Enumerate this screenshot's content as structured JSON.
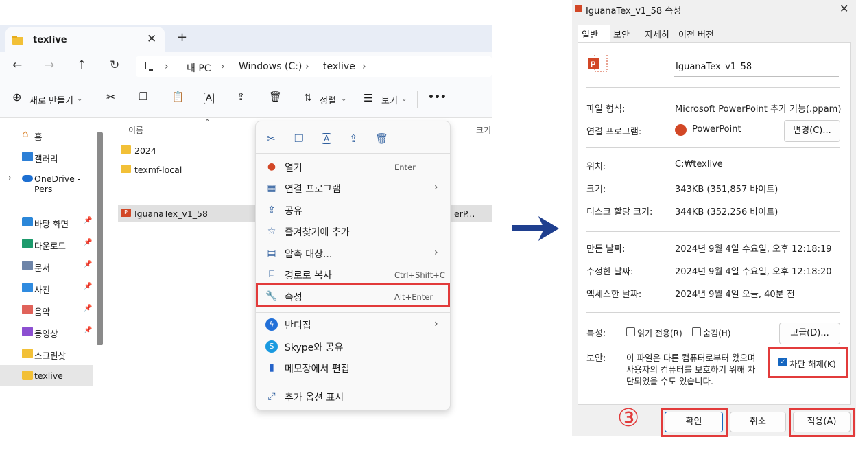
{
  "explorer": {
    "tab_title": "texlive",
    "breadcrumb": [
      "내 PC",
      "Windows (C:)",
      "texlive"
    ],
    "toolbar": {
      "new": "새로 만들기",
      "sort": "정렬",
      "view": "보기",
      "more": "•••"
    },
    "nav": {
      "home": "홈",
      "gallery": "갤러리",
      "onedrive": "OneDrive - Pers",
      "desktop": "바탕 화면",
      "downloads": "다운로드",
      "documents": "문서",
      "pictures": "사진",
      "music": "음악",
      "videos": "동영상",
      "screenshots": "스크린샷",
      "texlive": "texlive"
    },
    "columns": {
      "name": "이름",
      "size": "크기"
    },
    "files": [
      {
        "name": "2024"
      },
      {
        "name": "texmf-local"
      },
      {
        "name": "IguanaTex_v1_58",
        "type_fragment": "erP..."
      }
    ]
  },
  "context_menu": {
    "items": [
      {
        "label": "열기",
        "shortcut": "Enter"
      },
      {
        "label": "연결 프로그램"
      },
      {
        "label": "공유"
      },
      {
        "label": "즐겨찾기에 추가"
      },
      {
        "label": "압축 대상..."
      },
      {
        "label": "경로로 복사",
        "shortcut": "Ctrl+Shift+C"
      },
      {
        "label": "속성",
        "shortcut": "Alt+Enter"
      },
      {
        "label": "반디집"
      },
      {
        "label": "Skype와 공유"
      },
      {
        "label": "메모장에서 편집"
      },
      {
        "label": "추가 옵션 표시"
      }
    ]
  },
  "dialog": {
    "title": "IguanaTex_v1_58 속성",
    "tabs": [
      "일반",
      "보안",
      "자세히",
      "이전 버전"
    ],
    "filename": "IguanaTex_v1_58",
    "file_type_label": "파일 형식:",
    "file_type": "Microsoft PowerPoint 추가 기능(.ppam)",
    "opens_with_label": "연결 프로그램:",
    "opens_with": "PowerPoint",
    "change_button": "변경(C)...",
    "location_label": "위치:",
    "location": "C:₩texlive",
    "size_label": "크기:",
    "size": "343KB (351,857 바이트)",
    "size_on_disk_label": "디스크 할당 크기:",
    "size_on_disk": "344KB (352,256 바이트)",
    "created_label": "만든 날짜:",
    "created": "2024년 9월 4일 수요일, 오후 12:18:19",
    "modified_label": "수정한 날짜:",
    "modified": "2024년 9월 4일 수요일, 오후 12:18:20",
    "accessed_label": "액세스한 날짜:",
    "accessed": "2024년 9월 4일 오늘, 40분 전",
    "attributes_label": "특성:",
    "readonly": "읽기 전용(R)",
    "hidden": "숨김(H)",
    "advanced_button": "고급(D)...",
    "security_label": "보안:",
    "security_text": [
      "이 파일은 다른 컴퓨터로부터 왔으며",
      "사용자의 컴퓨터를 보호하기 위해 차",
      "단되었을 수도 있습니다."
    ],
    "unblock": "차단 해제(K)",
    "ok": "확인",
    "cancel": "취소",
    "apply": "적용(A)"
  },
  "annotation": {
    "step": "③",
    "highlight_color": "#e23b3b",
    "arrow_color": "#1f3f8f"
  }
}
